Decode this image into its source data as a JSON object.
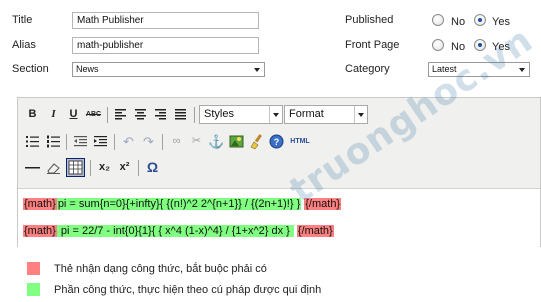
{
  "form": {
    "title_label": "Title",
    "title_value": "Math Publisher",
    "alias_label": "Alias",
    "alias_value": "math-publisher",
    "section_label": "Section",
    "section_value": "News",
    "published_label": "Published",
    "frontpage_label": "Front Page",
    "category_label": "Category",
    "category_value": "Latest",
    "no_label": "No",
    "yes_label": "Yes",
    "published_selected": "Yes",
    "frontpage_selected": "Yes"
  },
  "toolbar": {
    "bold": "B",
    "italic": "I",
    "underline": "U",
    "strike": "ABC",
    "styles": "Styles",
    "format": "Format",
    "html": "HTML",
    "subscript": "x₂",
    "superscript": "x²",
    "omega": "Ω"
  },
  "content": {
    "line1_open": "{math}",
    "line1_formula": "pi = sum{n=0}{+infty}{ {(n!)^2 2^{n+1}} / {(2n+1)!} }",
    "line1_close": "{/math}",
    "line2_open": "{math}",
    "line2_formula": " pi = 22/7 - int{0}{1}{ { x^4 (1-x)^4} / {1+x^2} dx } ",
    "line2_close": "{/math}"
  },
  "legend": {
    "red_text": "Thẻ nhận dạng công thức, bắt buộc phải có",
    "green_text": "Phần công thức, thực hiện theo cú pháp được qui định"
  },
  "watermark": "truonghoc.vn",
  "colors": {
    "tag_highlight": "#ff8080",
    "formula_highlight": "#80ff80",
    "accent_blue": "#1d4fa8"
  }
}
